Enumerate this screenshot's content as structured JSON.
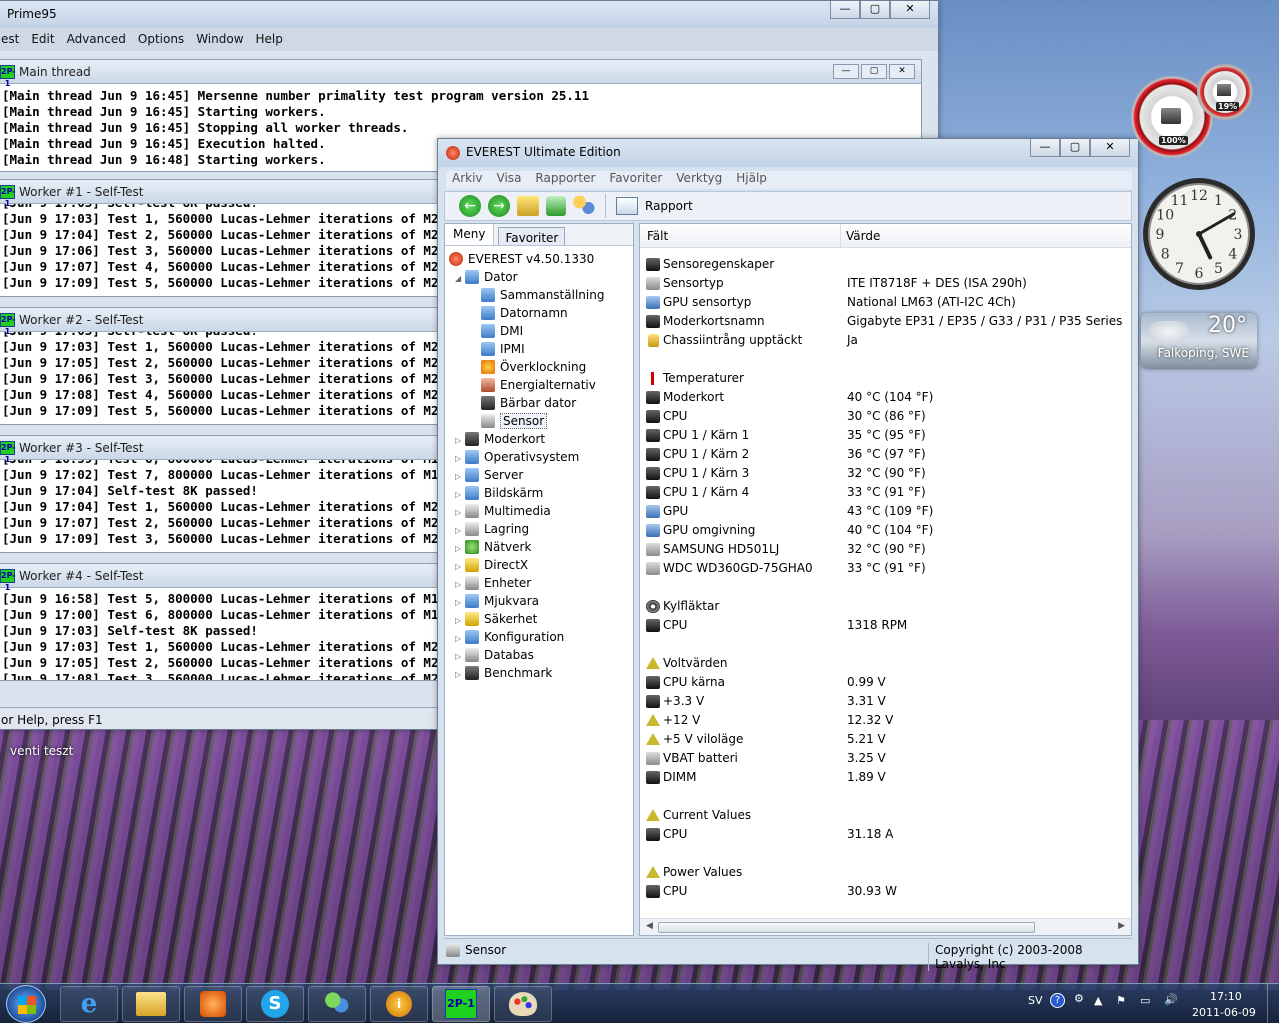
{
  "prime95": {
    "title": "Prime95",
    "menu": [
      "est",
      "Edit",
      "Advanced",
      "Options",
      "Window",
      "Help"
    ],
    "main_thread": {
      "title": "Main thread",
      "lines": [
        "[Main thread Jun 9 16:45] Mersenne number primality test program version 25.11",
        "[Main thread Jun 9 16:45] Starting workers.",
        "[Main thread Jun 9 16:45] Stopping all worker threads.",
        "[Main thread Jun 9 16:45] Execution halted.",
        "[Main thread Jun 9 16:48] Starting workers."
      ]
    },
    "workers": [
      {
        "title": "Worker #1 - Self-Test",
        "partial": "[Jun 9 17:03] Self-test 8K passed!",
        "lines": [
          "[Jun 9 17:03] Test 1, 560000 Lucas-Lehmer iterations of M212991 u",
          "[Jun 9 17:04] Test 2, 560000 Lucas-Lehmer iterations of M210415 u",
          "[Jun 9 17:06] Test 3, 560000 Lucas-Lehmer iterations of M208897 u",
          "[Jun 9 17:07] Test 4, 560000 Lucas-Lehmer iterations of M204799 u",
          "[Jun 9 17:09] Test 5, 560000 Lucas-Lehmer iterations of M200705 u"
        ]
      },
      {
        "title": "Worker #2 - Self-Test",
        "partial": "[Jun 9 17:03] Self-test 8K passed!",
        "lines": [
          "[Jun 9 17:03] Test 1, 560000 Lucas-Lehmer iterations of M212991 u",
          "[Jun 9 17:05] Test 2, 560000 Lucas-Lehmer iterations of M210415 u",
          "[Jun 9 17:06] Test 3, 560000 Lucas-Lehmer iterations of M208897 u",
          "[Jun 9 17:08] Test 4, 560000 Lucas-Lehmer iterations of M204799 u",
          "[Jun 9 17:09] Test 5, 560000 Lucas-Lehmer iterations of M200705 u"
        ]
      },
      {
        "title": "Worker #3 - Self-Test",
        "partial": "[Jun 9 16:59] Test 6, 800000 Lucas-Lehmer iterations of M155649 u",
        "lines": [
          "[Jun 9 17:02] Test 7, 800000 Lucas-Lehmer iterations of M147455 u",
          "[Jun 9 17:04] Self-test 8K passed!",
          "[Jun 9 17:04] Test 1, 560000 Lucas-Lehmer iterations of M212991 u",
          "[Jun 9 17:07] Test 2, 560000 Lucas-Lehmer iterations of M210415 u",
          "[Jun 9 17:09] Test 3, 560000 Lucas-Lehmer iterations of M208897 u"
        ]
      },
      {
        "title": "Worker #4 - Self-Test",
        "partial": "",
        "lines": [
          "[Jun 9 16:58] Test 5, 800000 Lucas-Lehmer iterations of M155649 u",
          "[Jun 9 17:00] Test 6, 800000 Lucas-Lehmer iterations of M153599 u",
          "[Jun 9 17:03] Self-test 8K passed!",
          "[Jun 9 17:03] Test 1, 560000 Lucas-Lehmer iterations of M212991 u",
          "[Jun 9 17:05] Test 2, 560000 Lucas-Lehmer iterations of M210415 u",
          "[Jun 9 17:08] Test 3, 560000 Lucas-Lehmer iterations of M208897 u"
        ]
      }
    ],
    "status": "or Help, press F1"
  },
  "desktop": {
    "label": "venti teszt"
  },
  "everest": {
    "title": "EVEREST Ultimate Edition",
    "menu": [
      "Arkiv",
      "Visa",
      "Rapporter",
      "Favoriter",
      "Verktyg",
      "Hjälp"
    ],
    "report_label": "Rapport",
    "tabs": [
      "Meny",
      "Favoriter"
    ],
    "tree_root": "EVEREST v4.50.1330",
    "tree": [
      {
        "label": "Dator",
        "level": 1,
        "icon": "b",
        "open": true
      },
      {
        "label": "Sammanställning",
        "level": 2,
        "icon": "b"
      },
      {
        "label": "Datornamn",
        "level": 2,
        "icon": "b"
      },
      {
        "label": "DMI",
        "level": 2,
        "icon": "b"
      },
      {
        "label": "IPMI",
        "level": 2,
        "icon": "b"
      },
      {
        "label": "Överklockning",
        "level": 2,
        "icon": "o"
      },
      {
        "label": "Energialternativ",
        "level": 2,
        "icon": "c"
      },
      {
        "label": "Bärbar dator",
        "level": 2,
        "icon": "k"
      },
      {
        "label": "Sensor",
        "level": 2,
        "icon": "g",
        "selected": true
      },
      {
        "label": "Moderkort",
        "level": 1,
        "icon": "k"
      },
      {
        "label": "Operativsystem",
        "level": 1,
        "icon": "b"
      },
      {
        "label": "Server",
        "level": 1,
        "icon": "b"
      },
      {
        "label": "Bildskärm",
        "level": 1,
        "icon": "b"
      },
      {
        "label": "Multimedia",
        "level": 1,
        "icon": "g"
      },
      {
        "label": "Lagring",
        "level": 1,
        "icon": "g"
      },
      {
        "label": "Nätverk",
        "level": 1,
        "icon": "gr"
      },
      {
        "label": "DirectX",
        "level": 1,
        "icon": "y"
      },
      {
        "label": "Enheter",
        "level": 1,
        "icon": "g"
      },
      {
        "label": "Mjukvara",
        "level": 1,
        "icon": "b"
      },
      {
        "label": "Säkerhet",
        "level": 1,
        "icon": "y"
      },
      {
        "label": "Konfiguration",
        "level": 1,
        "icon": "b"
      },
      {
        "label": "Databas",
        "level": 1,
        "icon": "g"
      },
      {
        "label": "Benchmark",
        "level": 1,
        "icon": "k"
      }
    ],
    "columns": [
      "Fält",
      "Värde"
    ],
    "rows": [
      {
        "type": "section",
        "field": "Sensoregenskaper",
        "icon": "chip"
      },
      {
        "field": "Sensortyp",
        "value": "ITE IT8718F + DES  (ISA 290h)",
        "icon": "hdd"
      },
      {
        "field": "GPU sensortyp",
        "value": "National LM63  (ATI-I2C 4Ch)",
        "icon": "chipb"
      },
      {
        "field": "Moderkortsnamn",
        "value": "Gigabyte EP31 / EP35 / G33 / P31 / P35 Series",
        "icon": "chip"
      },
      {
        "field": "Chassiintrång upptäckt",
        "value": "Ja",
        "icon": "lock"
      },
      {
        "type": "gap"
      },
      {
        "type": "section",
        "field": "Temperaturer",
        "icon": "therm"
      },
      {
        "field": "Moderkort",
        "value": "40 °C  (104 °F)",
        "icon": "chip"
      },
      {
        "field": "CPU",
        "value": "30 °C  (86 °F)",
        "icon": "chip"
      },
      {
        "field": "CPU 1 / Kärn 1",
        "value": "35 °C  (95 °F)",
        "icon": "chip"
      },
      {
        "field": "CPU 1 / Kärn 2",
        "value": "36 °C  (97 °F)",
        "icon": "chip"
      },
      {
        "field": "CPU 1 / Kärn 3",
        "value": "32 °C  (90 °F)",
        "icon": "chip"
      },
      {
        "field": "CPU 1 / Kärn 4",
        "value": "33 °C  (91 °F)",
        "icon": "chip"
      },
      {
        "field": "GPU",
        "value": "43 °C  (109 °F)",
        "icon": "chipb"
      },
      {
        "field": "GPU omgivning",
        "value": "40 °C  (104 °F)",
        "icon": "chipb"
      },
      {
        "field": "SAMSUNG HD501LJ",
        "value": "32 °C  (90 °F)",
        "icon": "hdd"
      },
      {
        "field": "WDC WD360GD-75GHA0",
        "value": "33 °C  (91 °F)",
        "icon": "hdd"
      },
      {
        "type": "gap"
      },
      {
        "type": "section",
        "field": "Kylfläktar",
        "icon": "fan"
      },
      {
        "field": "CPU",
        "value": "1318 RPM",
        "icon": "chip"
      },
      {
        "type": "gap"
      },
      {
        "type": "section",
        "field": "Voltvärden",
        "icon": "warn"
      },
      {
        "field": "CPU kärna",
        "value": "0.99 V",
        "icon": "chip"
      },
      {
        "field": "+3.3 V",
        "value": "3.31 V",
        "icon": "chip"
      },
      {
        "field": "+12 V",
        "value": "12.32 V",
        "icon": "warn"
      },
      {
        "field": "+5 V viloläge",
        "value": "5.21 V",
        "icon": "warn"
      },
      {
        "field": "VBAT batteri",
        "value": "3.25 V",
        "icon": "hdd"
      },
      {
        "field": "DIMM",
        "value": "1.89 V",
        "icon": "chip"
      },
      {
        "type": "gap"
      },
      {
        "type": "section",
        "field": "Current Values",
        "icon": "warn"
      },
      {
        "field": "CPU",
        "value": "31.18 A",
        "icon": "chip"
      },
      {
        "type": "gap"
      },
      {
        "type": "section",
        "field": "Power Values",
        "icon": "warn"
      },
      {
        "field": "CPU",
        "value": "30.93 W",
        "icon": "chip"
      }
    ],
    "status_left": "Sensor",
    "status_right": "Copyright (c) 2003-2008 Lavalys, Inc"
  },
  "gadgets": {
    "cpu_meter": {
      "cpu": "100%",
      "ram": "19%",
      "cpu_fraction": 1.0,
      "ram_fraction": 0.19
    },
    "clock": {
      "numerals": [
        "12",
        "1",
        "2",
        "3",
        "4",
        "5",
        "6",
        "7",
        "8",
        "9",
        "10",
        "11"
      ],
      "hour": 5.15,
      "minute": 10
    },
    "weather": {
      "temp": "20°",
      "location": "Falköping, SWE"
    }
  },
  "taskbar": {
    "language": "SV",
    "time": "17:10",
    "date": "2011-06-09",
    "apps": [
      "ie-icon",
      "explorer-icon",
      "media-player-icon",
      "skype-icon",
      "messenger-icon",
      "everest-icon",
      "prime95-icon",
      "paint-icon"
    ]
  }
}
